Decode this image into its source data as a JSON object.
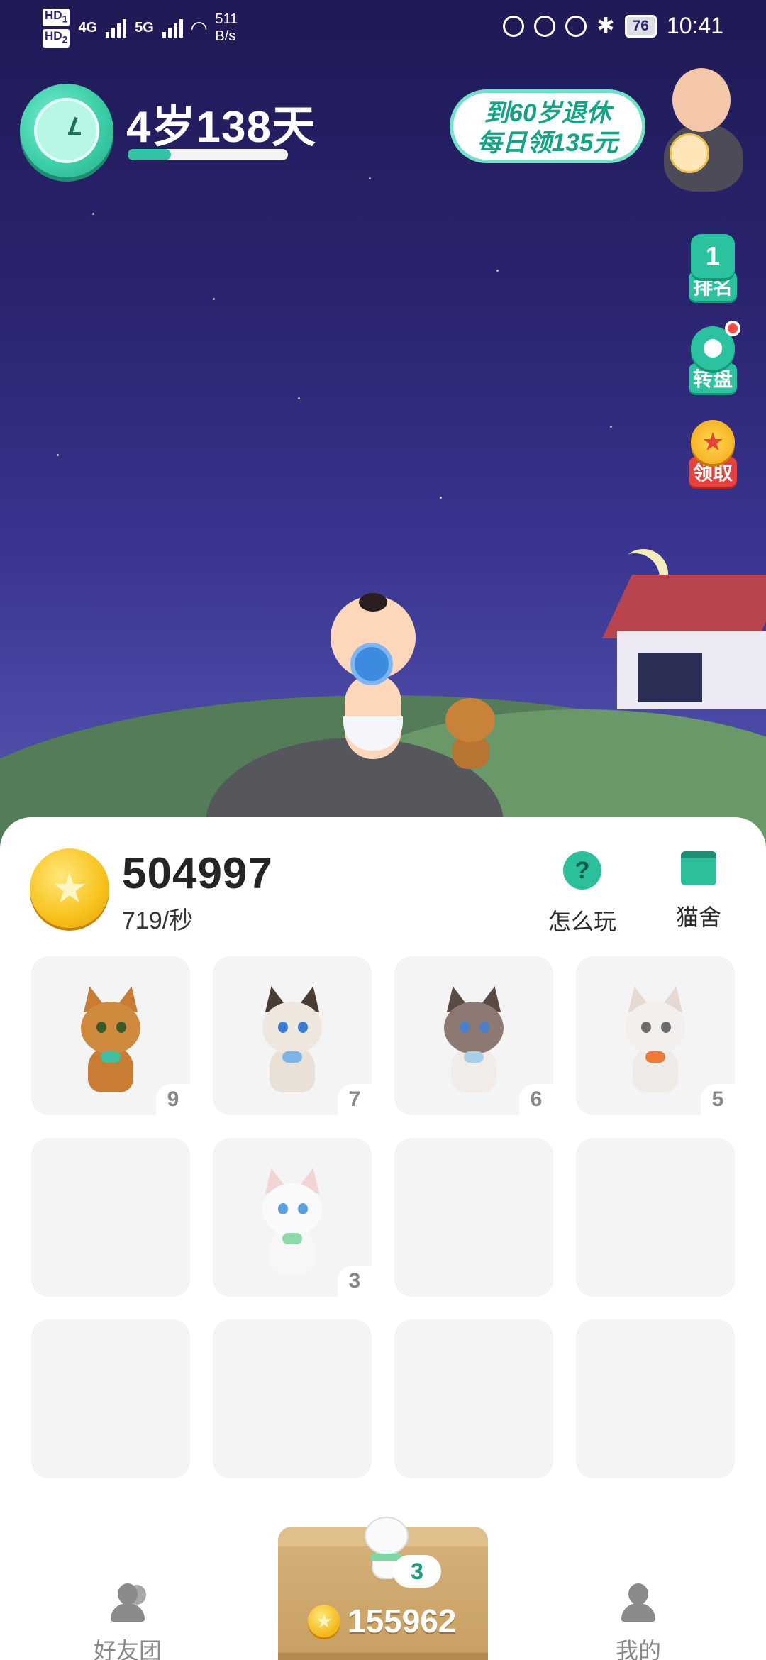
{
  "status_bar": {
    "sim1": "HD",
    "sim1_index": "1",
    "sim2": "HD",
    "sim2_index": "2",
    "net1": "4G",
    "net2": "5G",
    "speed_value": "511",
    "speed_unit": "B/s",
    "battery": "76",
    "time": "10:41"
  },
  "profile": {
    "age": "4岁138天",
    "age_progress": 0.27
  },
  "retire_banner": {
    "line1": "到60岁退休",
    "line2": "每日领135元"
  },
  "side_buttons": [
    {
      "icon": "rank-icon",
      "icon_text": "1",
      "label": "排名"
    },
    {
      "icon": "wheel-icon",
      "icon_text": "",
      "label": "转盘"
    },
    {
      "icon": "star-icon",
      "icon_text": "★",
      "label": "领取"
    }
  ],
  "wallet": {
    "balance": "504997",
    "rate": "719/秒"
  },
  "tools": {
    "help_label": "怎么玩",
    "help_icon_text": "?",
    "cattery_label": "猫舍"
  },
  "cat_grid": [
    {
      "level": "9",
      "cat": "orange-cat"
    },
    {
      "level": "7",
      "cat": "siamese-cat"
    },
    {
      "level": "6",
      "cat": "ragdoll-cat"
    },
    {
      "level": "5",
      "cat": "gray-cat"
    },
    {
      "level": "",
      "cat": ""
    },
    {
      "level": "3",
      "cat": "white-cat"
    },
    {
      "level": "",
      "cat": ""
    },
    {
      "level": "",
      "cat": ""
    },
    {
      "level": "",
      "cat": ""
    },
    {
      "level": "",
      "cat": ""
    },
    {
      "level": "",
      "cat": ""
    },
    {
      "level": "",
      "cat": ""
    }
  ],
  "nav": {
    "friends_label": "好友团",
    "me_label": "我的",
    "box_badge": "3",
    "box_coins": "155962"
  },
  "colors": {
    "accent": "#2bc39f",
    "sky_top": "#1f1a55",
    "coin": "#f7c21c"
  }
}
